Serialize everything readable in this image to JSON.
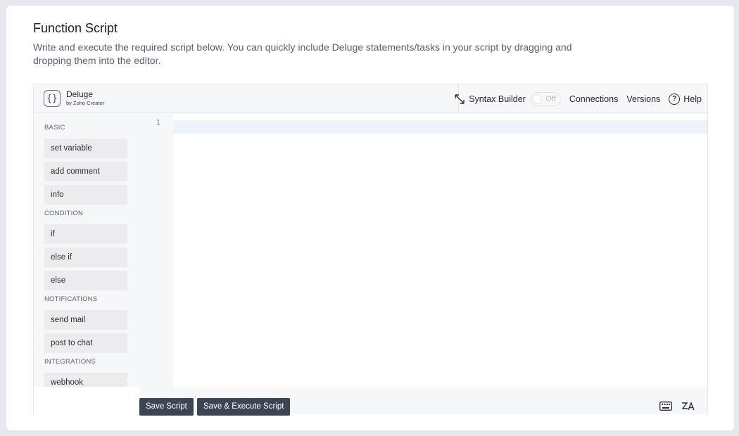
{
  "page": {
    "title": "Function Script",
    "description": "Write and execute the required script below. You can quickly include Deluge statements/tasks in your script by dragging and dropping them into the editor."
  },
  "toolbar": {
    "brand_name": "Deluge",
    "brand_sub": "by Zoho Creator",
    "syntax_builder": "Syntax Builder",
    "toggle_state": "Off",
    "connections": "Connections",
    "versions": "Versions",
    "help": "Help"
  },
  "palette": {
    "categories": [
      {
        "name": "BASIC",
        "items": [
          "set variable",
          "add comment",
          "info"
        ]
      },
      {
        "name": "CONDITION",
        "items": [
          "if",
          "else if",
          "else"
        ]
      },
      {
        "name": "NOTIFICATIONS",
        "items": [
          "send mail",
          "post to chat"
        ]
      },
      {
        "name": "INTEGRATIONS",
        "items": [
          "webhook"
        ]
      }
    ]
  },
  "editor": {
    "line_numbers": [
      "1"
    ]
  },
  "footer": {
    "save_label": "Save Script",
    "save_execute_label": "Save & Execute Script"
  },
  "colors": {
    "button_bg": "#3d4555",
    "active_line": "#eef3fb"
  }
}
